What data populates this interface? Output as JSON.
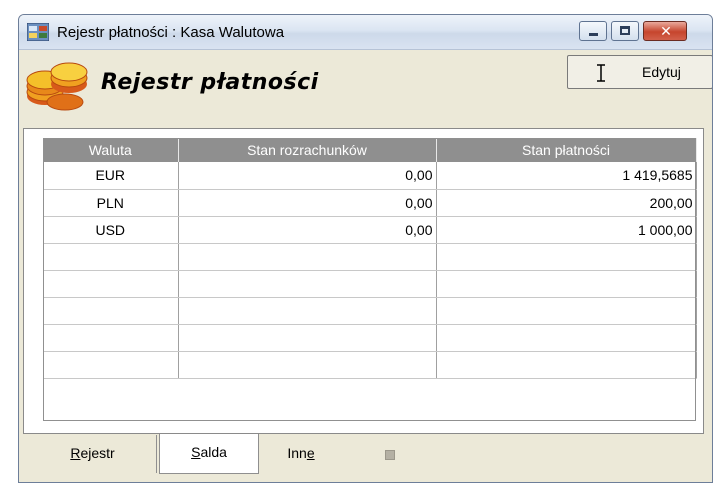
{
  "window": {
    "title": "Rejestr płatności : Kasa Walutowa",
    "icons": {
      "app": "register-app-icon",
      "minimize": "minimize-icon",
      "maximize": "maximize-icon",
      "close": "close-icon"
    },
    "close_glyph": "✕"
  },
  "header": {
    "title": "Rejestr płatności",
    "icon": "coins-icon",
    "edit_button": {
      "label": "Edytuj",
      "icon": "text-cursor-icon"
    }
  },
  "table": {
    "columns": [
      "Waluta",
      "Stan rozrachunków",
      "Stan płatności"
    ],
    "rows": [
      [
        "EUR",
        "0,00",
        "1 419,5685"
      ],
      [
        "PLN",
        "0,00",
        "200,00"
      ],
      [
        "USD",
        "0,00",
        "1 000,00"
      ],
      [
        "",
        "",
        ""
      ],
      [
        "",
        "",
        ""
      ],
      [
        "",
        "",
        ""
      ],
      [
        "",
        "",
        ""
      ],
      [
        "",
        "",
        ""
      ]
    ]
  },
  "tabs": [
    {
      "label": "Rejestr",
      "accel": "R",
      "rest": "ejestr",
      "active": false
    },
    {
      "label": "Salda",
      "accel": "S",
      "rest": "alda",
      "active": true
    },
    {
      "label": "Inne",
      "prefix": "Inn",
      "accel": "e",
      "active": false
    }
  ],
  "colors": {
    "header_bg": "#8f8f8f",
    "window_bg": "#ece9d8",
    "close_red": "#c6452d"
  }
}
